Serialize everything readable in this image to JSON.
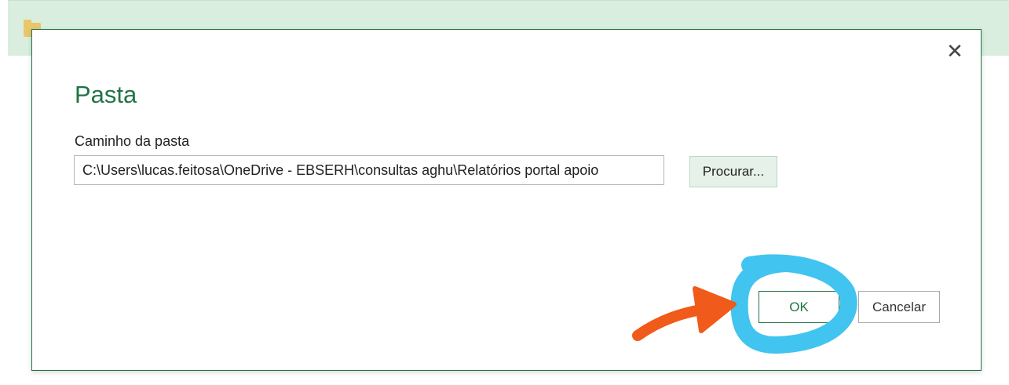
{
  "background": {
    "window_title": "…"
  },
  "dialog": {
    "title": "Pasta",
    "field_label": "Caminho da pasta",
    "folder_path": "C:\\Users\\lucas.feitosa\\OneDrive - EBSERH\\consultas aghu\\Relatórios portal apoio",
    "browse_label": "Procurar...",
    "ok_label": "OK",
    "cancel_label": "Cancelar",
    "close_glyph": "✕"
  },
  "colors": {
    "accent": "#217346",
    "highlight": "#41c4f0",
    "arrow": "#f05a1a"
  }
}
